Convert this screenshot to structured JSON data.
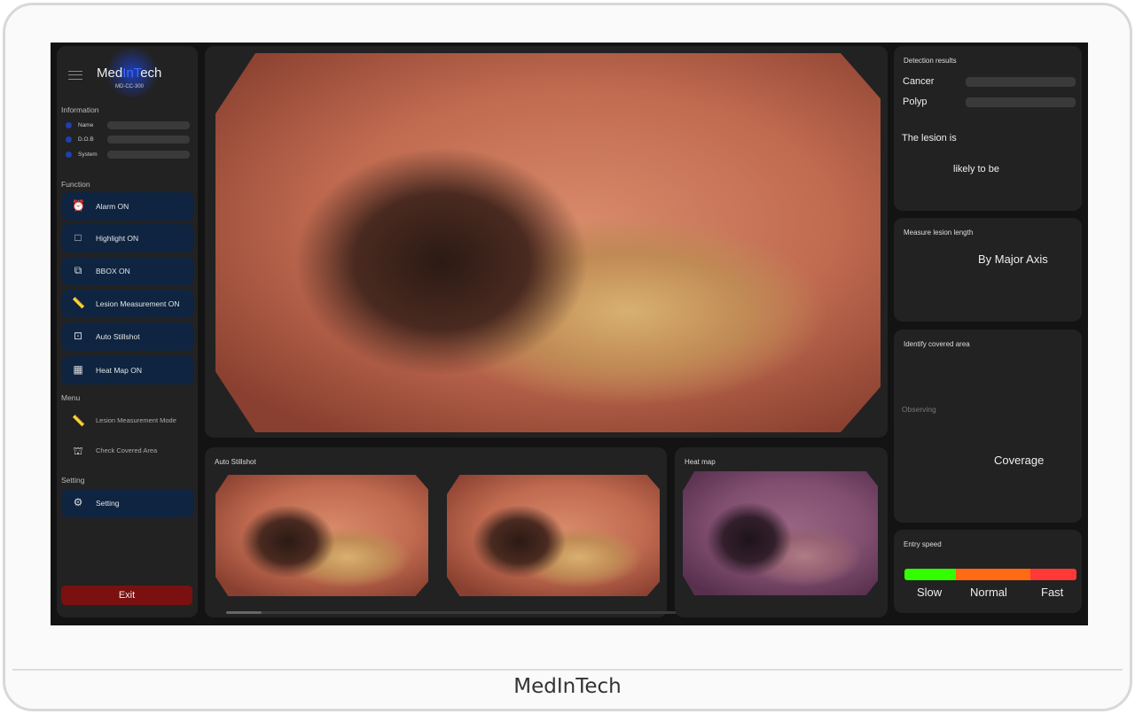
{
  "device_brand": "MedInTech",
  "logo": {
    "pre": "Med",
    "mid": "InT",
    "post": "ech",
    "model": "MD-CC-300"
  },
  "information": {
    "title": "Information",
    "fields": [
      "Name",
      "D.O.B",
      "System"
    ]
  },
  "function": {
    "title": "Function",
    "buttons": [
      "Alarm ON",
      "Highlight ON",
      "BBOX ON",
      "Lesion Measurement ON",
      "Auto Stillshot",
      "Heat Map ON"
    ]
  },
  "menu": {
    "title": "Menu",
    "items": [
      "Lesion Measurement Mode",
      "Check Covered Area"
    ]
  },
  "setting": {
    "title": "Setting",
    "button": "Setting"
  },
  "exit": "Exit",
  "auto_stillshot": {
    "title": "Auto Stillshot"
  },
  "heat_map": {
    "title": "Heat map"
  },
  "detection": {
    "title": "Detection results",
    "labels": [
      "Cancer",
      "Polyp"
    ],
    "line1": "The lesion is",
    "line2": "likely to be"
  },
  "measure": {
    "title": "Measure lesion length",
    "value": "By Major Axis"
  },
  "covered": {
    "title": "Identify covered area",
    "status": "Observing",
    "label": "Coverage"
  },
  "entry_speed": {
    "title": "Entry speed",
    "labels": [
      "Slow",
      "Normal",
      "Fast"
    ],
    "colors": [
      "#33ff00",
      "#ff6a13",
      "#ff3838"
    ]
  }
}
